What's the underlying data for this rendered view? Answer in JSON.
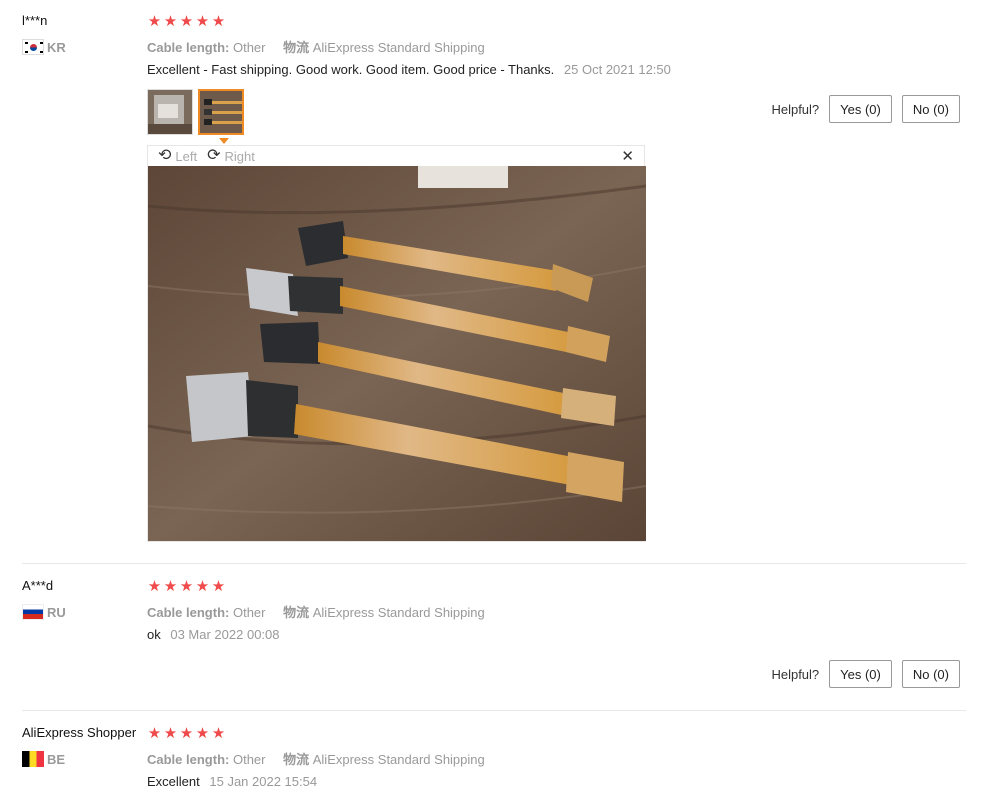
{
  "labels": {
    "cable_length_key": "Cable length:",
    "logistics_key": "物流",
    "helpful": "Helpful?",
    "rotate_left": "Left",
    "rotate_right": "Right"
  },
  "icons": {
    "star": "★",
    "rotate_left": "⟲",
    "rotate_right": "⟳",
    "close": "✕"
  },
  "colors": {
    "star": "#f04b4b",
    "active_thumb": "#f08a24"
  },
  "reviews": [
    {
      "user": "l***n",
      "country": "KR",
      "rating": 5,
      "cable_length": "Other",
      "logistics": "AliExpress Standard Shipping",
      "text": "Excellent - Fast shipping. Good work. Good item. Good price - Thanks.",
      "date": "25 Oct 2021 12:50",
      "yes": "Yes (0)",
      "no": "No (0)"
    },
    {
      "user": "A***d",
      "country": "RU",
      "rating": 5,
      "cable_length": "Other",
      "logistics": "AliExpress Standard Shipping",
      "text": "ok",
      "date": "03 Mar 2022 00:08",
      "yes": "Yes (0)",
      "no": "No (0)"
    },
    {
      "user": "AliExpress Shopper",
      "country": "BE",
      "rating": 5,
      "cable_length": "Other",
      "logistics": "AliExpress Standard Shipping",
      "text": "Excellent",
      "date": "15 Jan 2022 15:54"
    }
  ]
}
